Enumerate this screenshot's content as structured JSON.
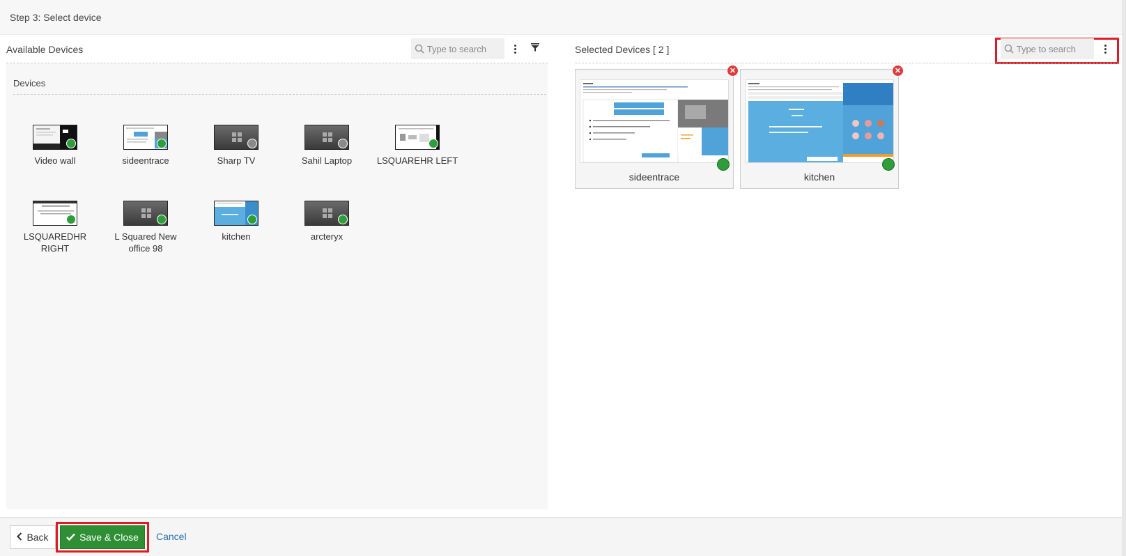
{
  "step": {
    "title": "Step 3: Select device"
  },
  "available": {
    "title": "Available Devices",
    "search_placeholder": "Type to search",
    "section_label": "Devices",
    "devices": [
      {
        "name": "Video wall",
        "status": "online",
        "thumb": "content"
      },
      {
        "name": "sideentrace",
        "status": "online",
        "thumb": "content"
      },
      {
        "name": "Sharp TV",
        "status": "offline",
        "thumb": "placeholder"
      },
      {
        "name": "Sahil Laptop",
        "status": "offline",
        "thumb": "placeholder"
      },
      {
        "name": "LSQUAREHR LEFT",
        "status": "online",
        "thumb": "content"
      },
      {
        "name": "LSQUAREDHR RIGHT",
        "status": "online",
        "thumb": "content"
      },
      {
        "name": "L Squared New office 98",
        "status": "online",
        "thumb": "placeholder"
      },
      {
        "name": "kitchen",
        "status": "online",
        "thumb": "content"
      },
      {
        "name": "arcteryx",
        "status": "online",
        "thumb": "placeholder"
      }
    ]
  },
  "selected": {
    "title": "Selected Devices [ 2 ]",
    "search_placeholder": "Type to search",
    "devices": [
      {
        "name": "sideentrace",
        "status": "online"
      },
      {
        "name": "kitchen",
        "status": "online"
      }
    ]
  },
  "footer": {
    "back_label": "Back",
    "save_label": "Save & Close",
    "cancel_label": "Cancel"
  },
  "colors": {
    "online": "#2e9e3a",
    "offline": "#8a8a8a",
    "highlight": "#e01b24",
    "save_button": "#2f8f35",
    "link": "#2a6fb0"
  }
}
